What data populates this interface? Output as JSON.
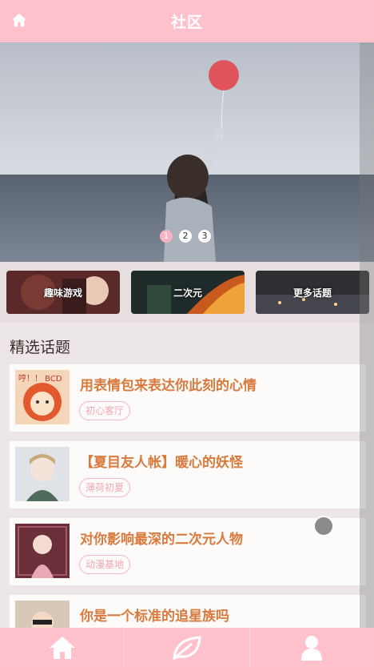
{
  "header": {
    "title": "社区"
  },
  "banner": {
    "dots": [
      "1",
      "2",
      "3"
    ],
    "active_dot": 1
  },
  "categories": [
    {
      "label": "趣味游戏"
    },
    {
      "label": "二次元"
    },
    {
      "label": "更多话题"
    }
  ],
  "section": {
    "title": "精选话题"
  },
  "topics": [
    {
      "title": "用表情包来表达你此刻的心情",
      "tag": "初心客厅",
      "thumb_text": "哼！！ BCD"
    },
    {
      "title": "【夏目友人帐】暖心的妖怪",
      "tag": "薄荷初夏"
    },
    {
      "title": "对你影响最深的二次元人物",
      "tag": "动漫基地"
    },
    {
      "title": "你是一个标准的追星族吗",
      "tag": ""
    }
  ],
  "tabbar": {
    "icons": [
      "home-icon",
      "leaf-icon",
      "user-icon"
    ]
  },
  "colors": {
    "accent": "#ffc2cc",
    "title_orange": "#d97a3c",
    "tag_pink": "#f0a7b9"
  }
}
